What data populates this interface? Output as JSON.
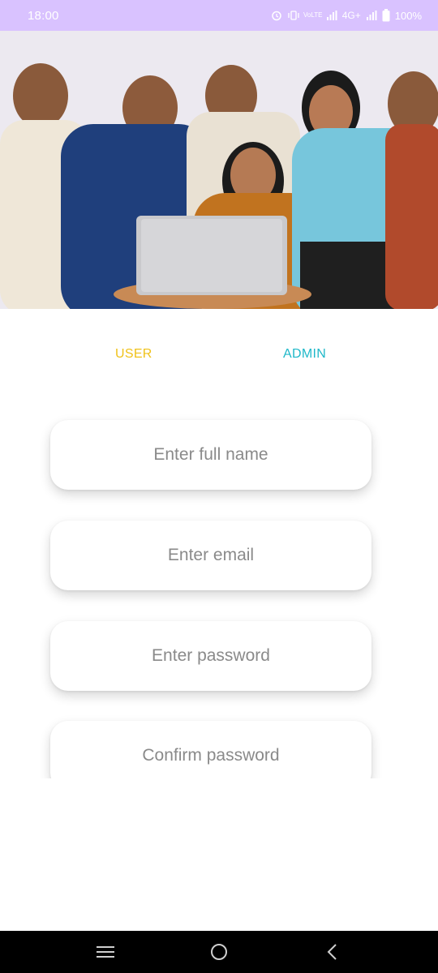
{
  "status_bar": {
    "time": "18:00",
    "network": "4G+",
    "volte_label": "VoLTE",
    "battery": "100%"
  },
  "tabs": {
    "user": "USER",
    "admin": "ADMIN"
  },
  "form": {
    "full_name_placeholder": "Enter full name",
    "email_placeholder": "Enter email",
    "password_placeholder": "Enter password",
    "confirm_password_placeholder": "Confirm password"
  },
  "colors": {
    "status_bar": "#d9c2ff",
    "user_tab": "#f0c21a",
    "admin_tab": "#1fb8c9",
    "placeholder": "#8a8a8a"
  },
  "icons": [
    "alarm-icon",
    "vibrate-icon",
    "signal-icon",
    "battery-icon",
    "menu-icon",
    "home-icon",
    "back-icon"
  ]
}
